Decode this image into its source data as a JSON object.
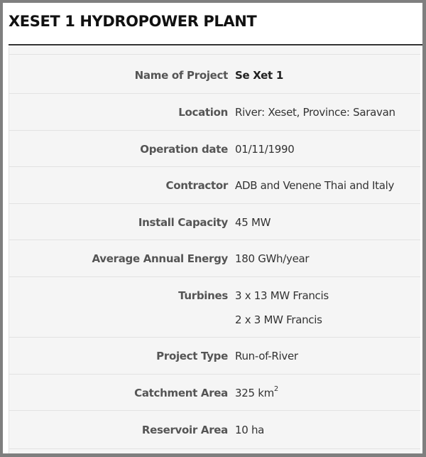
{
  "header": {
    "title": "XESET 1 HYDROPOWER PLANT"
  },
  "rows": [
    {
      "label": "Name of Project",
      "value": "Se Xet 1"
    },
    {
      "label": "Location",
      "value": "River: Xeset, Province: Saravan"
    },
    {
      "label": "Operation date",
      "value": "01/11/1990"
    },
    {
      "label": "Contractor",
      "value": "ADB and Venene Thai and Italy"
    },
    {
      "label": "Install Capacity",
      "value": "45 MW"
    },
    {
      "label": "Average Annual Energy",
      "value": "180 GWh/year"
    },
    {
      "label": "Turbines",
      "value": "3 x 13 MW Francis",
      "value2": "2 x 3 MW Francis"
    },
    {
      "label": "Project Type",
      "value": "Run-of-River"
    },
    {
      "label": "Catchment Area",
      "value": "325 km",
      "unit_sup": "2"
    },
    {
      "label": "Reservoir Area",
      "value": "10 ha"
    }
  ]
}
